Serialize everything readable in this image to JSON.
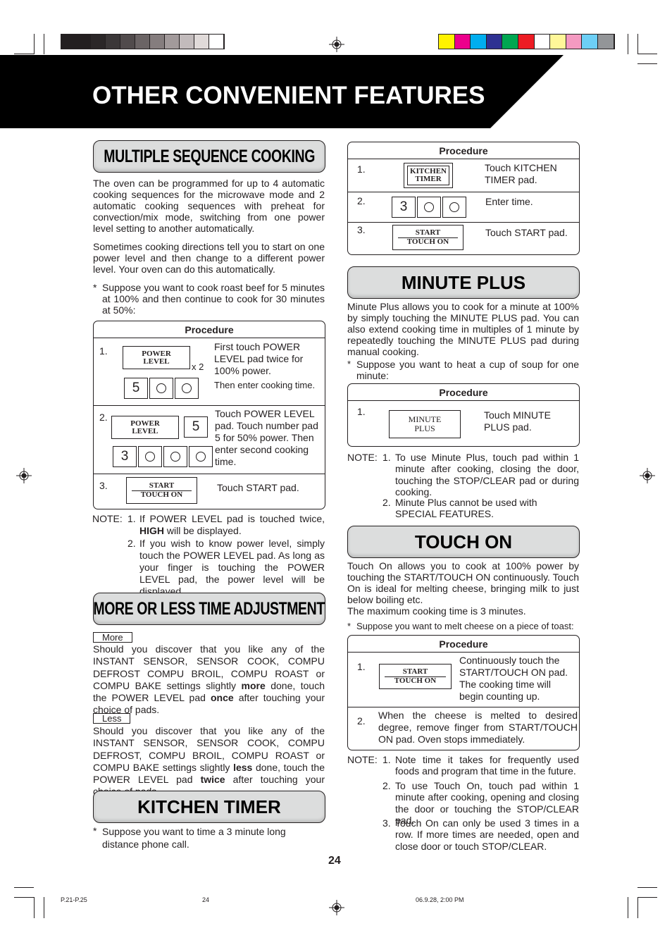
{
  "page": {
    "title": "OTHER CONVENIENT FEATURES",
    "page_number": "24"
  },
  "print_marks": {
    "gray_swatches": [
      "#231f20",
      "#231f20",
      "#2b2728",
      "#3b3738",
      "#514b4c",
      "#6b6465",
      "#857d7e",
      "#a29a9b",
      "#c2bbbc",
      "#e0dad9",
      "#ffffff"
    ],
    "color_swatches": [
      "#fff200",
      "#ec008c",
      "#00aeef",
      "#2e3192",
      "#00a651",
      "#ed1c24",
      "#ffffff",
      "#fff799",
      "#f49ac1",
      "#6dcff6",
      "#939598"
    ],
    "footer_left": "P.21-P.25",
    "footer_mid": "24",
    "footer_right": "06.9.28, 2:00 PM"
  },
  "multiple_sequence": {
    "heading": "MULTIPLE SEQUENCE COOKING",
    "para1": "The oven can be programmed for up to 4 automatic cooking sequences for the microwave mode and 2 automatic cooking sequences with preheat for convection/mix mode, switching from one power level setting to another automatically.",
    "para2": "Sometimes cooking directions tell you to start on one power level and then change to a different power level. Your oven can do this automatically.",
    "bullet": "Suppose you want to cook roast beef for 5 minutes at 100% and then continue to cook for 30 minutes at 50%:",
    "procedure": {
      "header": "Procedure",
      "steps": [
        {
          "num": "1.",
          "pad": [
            "POWER",
            "LEVEL"
          ],
          "multiplier": "x 2",
          "digits": [
            "5",
            "○",
            "○"
          ],
          "text": "First touch POWER LEVEL pad twice for 100% power.",
          "text2": "Then enter cooking time."
        },
        {
          "num": "2.",
          "pad": [
            "POWER",
            "LEVEL"
          ],
          "digit_single": "5",
          "digits": [
            "3",
            "○",
            "○"
          ],
          "text": "Touch POWER LEVEL pad. Touch number pad 5 for 50% power. Then enter second cooking time."
        },
        {
          "num": "3.",
          "pad": [
            "START",
            "TOUCH ON"
          ],
          "text": "Touch START pad."
        }
      ]
    },
    "note_label": "NOTE:",
    "notes": [
      {
        "num": "1.",
        "pre": "If POWER LEVEL pad is touched twice, ",
        "bold": "HIGH",
        "post": " will be displayed."
      },
      {
        "num": "2.",
        "text": "If you wish to know power level, simply touch the POWER LEVEL pad. As long as your finger is touching the POWER LEVEL pad, the power level will be displayed."
      }
    ]
  },
  "more_less": {
    "heading": "MORE OR LESS TIME ADJUSTMENT",
    "more_tag": "More",
    "more_text_pre": "Should you discover that you like any of the INSTANT SENSOR, SENSOR COOK, COMPU DEFROST COMPU BROIL, COMPU ROAST or COMPU BAKE settings slightly ",
    "more_bold": "more",
    "more_text_mid": " done, touch the POWER LEVEL pad ",
    "more_bold2": "once",
    "more_text_post": " after touching your choice of pads.",
    "less_tag": "Less",
    "less_text_pre": "Should you discover that you like any of the INSTANT SENSOR, SENSOR COOK, COMPU DEFROST, COMPU BROIL, COMPU ROAST or COMPU BAKE settings slightly ",
    "less_bold": "less",
    "less_text_mid": " done, touch the POWER LEVEL pad ",
    "less_bold2": "twice",
    "less_text_post": " after touching your choice of pads."
  },
  "kitchen_timer": {
    "heading": "KITCHEN TIMER",
    "bullet": "Suppose you want to time a 3 minute long distance phone call.",
    "procedure": {
      "header": "Procedure",
      "steps": [
        {
          "num": "1.",
          "pad": [
            "KITCHEN",
            "TIMER"
          ],
          "text": "Touch KITCHEN TIMER pad."
        },
        {
          "num": "2.",
          "digits": [
            "3",
            "○",
            "○"
          ],
          "text": "Enter time."
        },
        {
          "num": "3.",
          "pad": [
            "START",
            "TOUCH ON"
          ],
          "text": "Touch START pad."
        }
      ]
    }
  },
  "minute_plus": {
    "heading": "MINUTE PLUS",
    "para": "Minute Plus allows you to cook for a minute at 100% by simply touching the MINUTE PLUS pad. You can also extend cooking time in multiples of 1 minute by repeatedly touching the MINUTE PLUS pad during manual cooking.",
    "bullet": "Suppose you want to heat a cup of soup for one minute:",
    "procedure": {
      "header": "Procedure",
      "steps": [
        {
          "num": "1.",
          "pad": [
            "MINUTE",
            "PLUS"
          ],
          "text": "Touch MINUTE PLUS pad."
        }
      ]
    },
    "note_label": "NOTE:",
    "notes": [
      {
        "num": "1.",
        "text": "To use Minute Plus, touch pad within 1 minute after cooking, closing the door, touching the STOP/CLEAR pad or during cooking."
      },
      {
        "num": "2.",
        "text": "Minute Plus cannot be used with SPECIAL FEATURES."
      }
    ]
  },
  "touch_on": {
    "heading": "TOUCH ON",
    "para": "Touch On allows you to cook at 100% power by touching the START/TOUCH ON continuously. Touch On is ideal for melting cheese, bringing milk to just below boiling etc.",
    "para2": "The maximum cooking time is 3 minutes.",
    "bullet": "Suppose you want to melt cheese on a piece of toast:",
    "procedure": {
      "header": "Procedure",
      "steps": [
        {
          "num": "1.",
          "pad": [
            "START",
            "TOUCH ON"
          ],
          "text": "Continuously touch the START/TOUCH ON pad. The cooking time will begin counting up."
        },
        {
          "num": "2.",
          "text": "When the cheese is melted to desired degree, remove finger from START/TOUCH ON pad. Oven stops immediately."
        }
      ]
    },
    "note_label": "NOTE:",
    "notes": [
      {
        "num": "1.",
        "text": "Note time it takes for frequently used foods and program that time in the future."
      },
      {
        "num": "2.",
        "text": "To use Touch On, touch pad within 1 minute after cooking, opening and closing the door or touching the STOP/CLEAR pad."
      },
      {
        "num": "3.",
        "text": "Touch On can only be used 3 times in a row. If more times are needed, open and close door or touch STOP/CLEAR."
      }
    ]
  },
  "bullet_symbol": "*"
}
